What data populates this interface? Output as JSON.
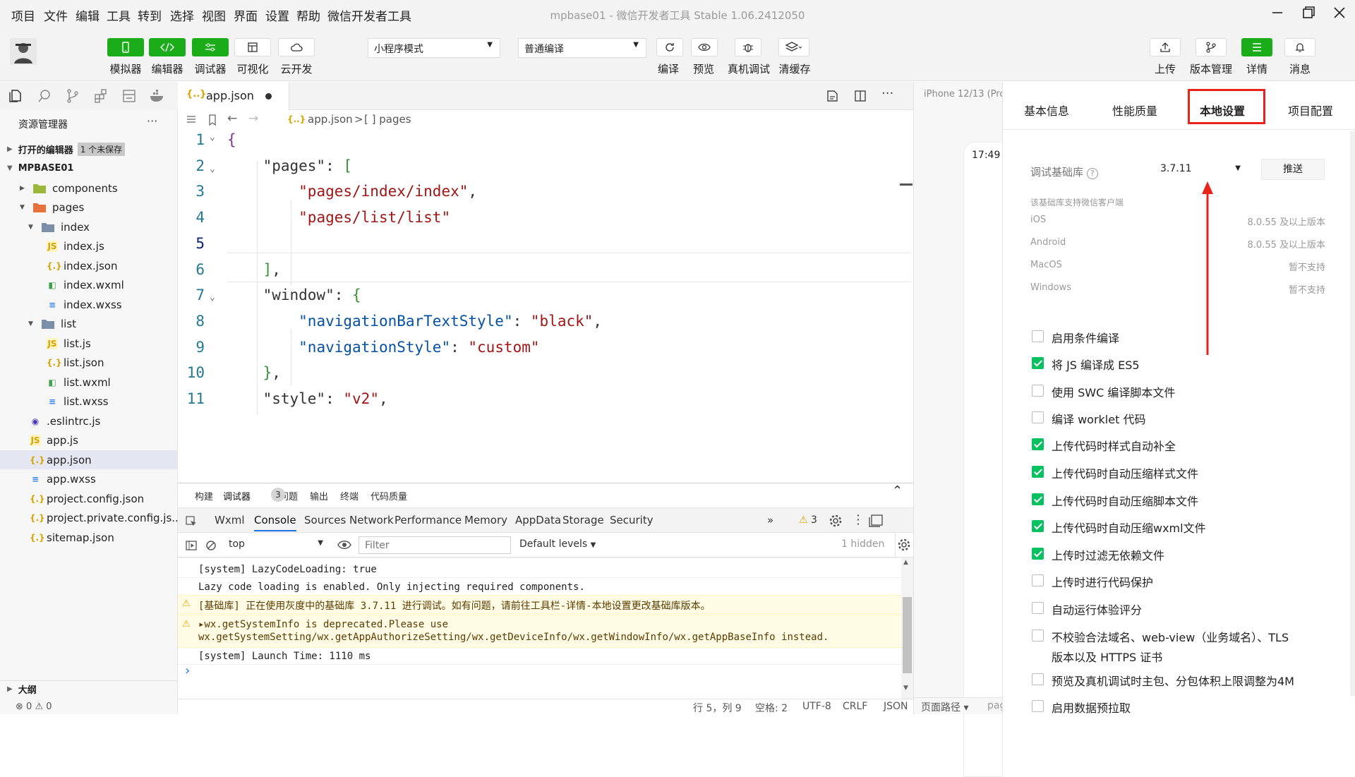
{
  "menu": [
    "项目",
    "文件",
    "编辑",
    "工具",
    "转到",
    "选择",
    "视图",
    "界面",
    "设置",
    "帮助",
    "微信开发者工具"
  ],
  "window_title": "mpbase01 - 微信开发者工具 Stable 1.06.2412050",
  "toolbar": {
    "left_buttons": [
      "模拟器",
      "编辑器",
      "调试器",
      "可视化",
      "云开发"
    ],
    "mode_select": "小程序模式",
    "compile_select": "普通编译",
    "mid_buttons": [
      "编译",
      "预览",
      "真机调试",
      "清缓存"
    ],
    "right_buttons": [
      "上传",
      "版本管理",
      "详情",
      "消息"
    ]
  },
  "explorer": {
    "title": "资源管理器",
    "more": "···",
    "open_editors": "打开的编辑器",
    "unsaved_badge": "1 个未保存",
    "project": "MPBASE01",
    "outline": "大纲",
    "problems_errors": "0",
    "problems_warnings": "0",
    "tree": [
      {
        "name": "components",
        "depth": 1,
        "kind": "folder",
        "open": false
      },
      {
        "name": "pages",
        "depth": 1,
        "kind": "folder",
        "open": true
      },
      {
        "name": "index",
        "depth": 2,
        "kind": "folder",
        "open": true
      },
      {
        "name": "index.js",
        "depth": 3,
        "kind": "js"
      },
      {
        "name": "index.json",
        "depth": 3,
        "kind": "json"
      },
      {
        "name": "index.wxml",
        "depth": 3,
        "kind": "wxml"
      },
      {
        "name": "index.wxss",
        "depth": 3,
        "kind": "wxss"
      },
      {
        "name": "list",
        "depth": 2,
        "kind": "folder",
        "open": true
      },
      {
        "name": "list.js",
        "depth": 3,
        "kind": "js"
      },
      {
        "name": "list.json",
        "depth": 3,
        "kind": "json"
      },
      {
        "name": "list.wxml",
        "depth": 3,
        "kind": "wxml"
      },
      {
        "name": "list.wxss",
        "depth": 3,
        "kind": "wxss"
      },
      {
        "name": ".eslintrc.js",
        "depth": 1,
        "kind": "eslint"
      },
      {
        "name": "app.js",
        "depth": 1,
        "kind": "js"
      },
      {
        "name": "app.json",
        "depth": 1,
        "kind": "json",
        "selected": true
      },
      {
        "name": "app.wxss",
        "depth": 1,
        "kind": "wxss"
      },
      {
        "name": "project.config.json",
        "depth": 1,
        "kind": "json"
      },
      {
        "name": "project.private.config.js...",
        "depth": 1,
        "kind": "json"
      },
      {
        "name": "sitemap.json",
        "depth": 1,
        "kind": "json"
      }
    ]
  },
  "editor": {
    "tab": "app.json",
    "breadcrumb_file": "app.json",
    "breadcrumb_sep": ">",
    "breadcrumb_node": "[ ] pages",
    "line_numbers": [
      "1",
      "2",
      "3",
      "4",
      "5",
      "6",
      "7",
      "8",
      "9",
      "10",
      "11"
    ],
    "lines": [
      [
        {
          "t": "{",
          "c": "brk"
        }
      ],
      [
        {
          "t": "    "
        },
        {
          "t": "\"pages\"",
          "c": "k"
        },
        {
          "t": ": "
        },
        {
          "t": "[",
          "c": "brk2"
        }
      ],
      [
        {
          "t": "        "
        },
        {
          "t": "\"pages/index/index\"",
          "c": "val"
        },
        {
          "t": ","
        }
      ],
      [
        {
          "t": "        "
        },
        {
          "t": "\"pages/list/list\"",
          "c": "val"
        }
      ],
      [
        {
          "t": ""
        }
      ],
      [
        {
          "t": "    "
        },
        {
          "t": "]",
          "c": "brk2"
        },
        {
          "t": ","
        }
      ],
      [
        {
          "t": "    "
        },
        {
          "t": "\"window\"",
          "c": "k"
        },
        {
          "t": ": "
        },
        {
          "t": "{",
          "c": "brk2"
        }
      ],
      [
        {
          "t": "        "
        },
        {
          "t": "\"navigationBarTextStyle\"",
          "c": "key"
        },
        {
          "t": ": "
        },
        {
          "t": "\"black\"",
          "c": "val"
        },
        {
          "t": ","
        }
      ],
      [
        {
          "t": "        "
        },
        {
          "t": "\"navigationStyle\"",
          "c": "key"
        },
        {
          "t": ": "
        },
        {
          "t": "\"custom\"",
          "c": "val"
        }
      ],
      [
        {
          "t": "    "
        },
        {
          "t": "}",
          "c": "brk2"
        },
        {
          "t": ","
        }
      ],
      [
        {
          "t": "    "
        },
        {
          "t": "\"style\"",
          "c": "k"
        },
        {
          "t": ": "
        },
        {
          "t": "\"v2\"",
          "c": "val"
        },
        {
          "t": ","
        }
      ]
    ]
  },
  "devtools": {
    "top_tabs": [
      "构建",
      "调试器",
      "问题",
      "输出",
      "终端",
      "代码质量"
    ],
    "debugger_badge": "3",
    "panel_tabs": [
      "Wxml",
      "Console",
      "Sources",
      "Network",
      "Performance",
      "Memory",
      "AppData",
      "Storage",
      "Security"
    ],
    "more_tabs": "»",
    "warn_count": "3",
    "context": "top",
    "filter_placeholder": "Filter",
    "levels": "Default levels",
    "hidden": "1 hidden",
    "log": [
      "[system] LazyCodeLoading: true",
      "Lazy code loading is enabled. Only injecting required components.",
      "[基础库] 正在使用灰度中的基础库 3.7.11 进行调试。如有问题，请前往工具栏-详情-本地设置更改基础库版本。",
      "▸wx.getSystemInfo is deprecated.Please use",
      "wx.getSystemSetting/wx.getAppAuthorizeSetting/wx.getDeviceInfo/wx.getWindowInfo/wx.getAppBaseInfo instead.",
      "[system] Launch Time: 1110 ms"
    ],
    "prompt": "›"
  },
  "statusbar": [
    "行 5，列 9",
    "空格: 2",
    "UTF-8",
    "CRLF",
    "JSON"
  ],
  "simulator": {
    "device": "iPhone 12/13 (Pro",
    "time": "17:49",
    "footer": "页面路径 ▾",
    "footer_right": "pag"
  },
  "details": {
    "tabs": [
      "基本信息",
      "性能质量",
      "本地设置",
      "项目配置"
    ],
    "active_tab": "本地设置",
    "highlight_color": "#e8231a",
    "lib_label": "调试基础库",
    "lib_version": "3.7.11",
    "push": "推送",
    "support_title": "该基础库支持微信客户端",
    "support": [
      {
        "os": "iOS",
        "v": "8.0.55 及以上版本"
      },
      {
        "os": "Android",
        "v": "8.0.55 及以上版本"
      },
      {
        "os": "MacOS",
        "v": "暂不支持"
      },
      {
        "os": "Windows",
        "v": "暂不支持"
      }
    ],
    "options": [
      {
        "label": "启用条件编译",
        "checked": false
      },
      {
        "label": "将 JS 编译成 ES5",
        "checked": true
      },
      {
        "label": "使用 SWC 编译脚本文件",
        "checked": false
      },
      {
        "label": "编译 worklet 代码",
        "checked": false
      },
      {
        "label": "上传代码时样式自动补全",
        "checked": true
      },
      {
        "label": "上传代码时自动压缩样式文件",
        "checked": true
      },
      {
        "label": "上传代码时自动压缩脚本文件",
        "checked": true
      },
      {
        "label": "上传代码时自动压缩wxml文件",
        "checked": true
      },
      {
        "label": "上传时过滤无依赖文件",
        "checked": true
      },
      {
        "label": "上传时进行代码保护",
        "checked": false
      },
      {
        "label": "自动运行体验评分",
        "checked": false
      },
      {
        "label": "不校验合法域名、web-view（业务域名）、TLS",
        "label2": "版本以及 HTTPS 证书",
        "checked": false
      },
      {
        "label": "预览及真机调试时主包、分包体积上限调整为4M",
        "checked": false
      },
      {
        "label": "启用数据预拉取",
        "checked": false
      }
    ]
  }
}
